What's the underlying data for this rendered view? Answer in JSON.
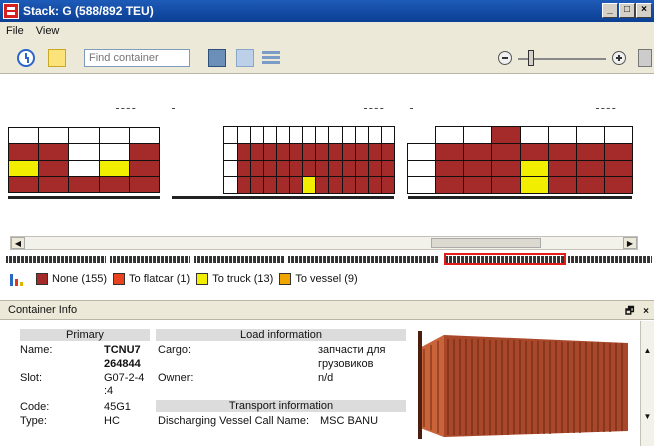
{
  "window": {
    "title": "Stack: G (588/892 TEU)",
    "min": "_",
    "max": "□",
    "close": "×"
  },
  "menu": {
    "file": "File",
    "view": "View"
  },
  "toolbar": {
    "search_placeholder": "Find container"
  },
  "legend": [
    {
      "label": "None (155)",
      "color": "#a52a2a"
    },
    {
      "label": "To flatcar (1)",
      "color": "#e8431e"
    },
    {
      "label": "To truck (13)",
      "color": "#f2ee00"
    },
    {
      "label": "To vessel (9)",
      "color": "#f0a500"
    }
  ],
  "panel": {
    "title": "Container Info",
    "buttons": "🗗 ×"
  },
  "info": {
    "primary_header": "Primary",
    "load_header": "Load information",
    "transport_header": "Transport information",
    "name_label": "Name:",
    "name_value_1": "TCNU7",
    "name_value_2": "264844",
    "slot_label": "Slot:",
    "slot_value_1": "G07-2-4",
    "slot_value_2": ":4",
    "code_label": "Code:",
    "code_value": "45G1",
    "type_label": "Type:",
    "type_value": "HC",
    "cargo_label": "Cargo:",
    "cargo_value_1": "запчасти для",
    "cargo_value_2": "грузовиков",
    "owner_label": "Owner:",
    "owner_value": "n/d",
    "vessel_label": "Discharging Vessel Call Name:",
    "vessel_value": "MSC BANU"
  },
  "stacks": [
    {
      "columns": 5,
      "rows": [
        [
          "W",
          "W",
          "W",
          "W",
          "W"
        ],
        [
          "N",
          "N",
          "W",
          "W",
          "N"
        ],
        [
          "T",
          "N",
          "W",
          "T",
          "N"
        ],
        [
          "N",
          "N",
          "N",
          "N",
          "N"
        ]
      ]
    },
    {
      "columns": 17,
      "rows": [
        [
          "E",
          "E",
          "E",
          "E",
          "W",
          "W",
          "W",
          "W",
          "W",
          "W",
          "W",
          "W",
          "W",
          "W",
          "W",
          "W",
          "W"
        ],
        [
          "E",
          "E",
          "E",
          "E",
          "W",
          "N",
          "N",
          "N",
          "N",
          "N",
          "N",
          "N",
          "N",
          "N",
          "N",
          "N",
          "N"
        ],
        [
          "E",
          "E",
          "E",
          "E",
          "W",
          "N",
          "N",
          "N",
          "N",
          "N",
          "N",
          "N",
          "N",
          "N",
          "N",
          "N",
          "N"
        ],
        [
          "E",
          "E",
          "E",
          "E",
          "W",
          "N",
          "N",
          "N",
          "N",
          "N",
          "T",
          "N",
          "N",
          "N",
          "N",
          "N",
          "N"
        ]
      ]
    },
    {
      "columns": 8,
      "rows": [
        [
          "E",
          "W",
          "W",
          "N",
          "W",
          "W",
          "W",
          "W"
        ],
        [
          "W",
          "N",
          "N",
          "N",
          "N",
          "N",
          "N",
          "N"
        ],
        [
          "W",
          "N",
          "N",
          "N",
          "T",
          "N",
          "N",
          "N"
        ],
        [
          "W",
          "N",
          "N",
          "N",
          "T",
          "N",
          "N",
          "N"
        ]
      ]
    }
  ]
}
